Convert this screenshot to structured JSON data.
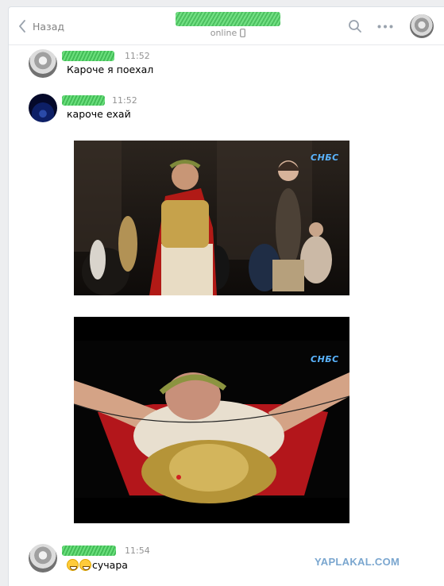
{
  "header": {
    "back_label": "Назад",
    "status": "online"
  },
  "messages": [
    {
      "time": "11:52",
      "text": "Кароче я поехал"
    },
    {
      "time": "11:52",
      "text": "кароче ехай"
    },
    {
      "time": "11:54",
      "text": "сучара"
    }
  ],
  "photos": [
    {
      "channel_logo": "СНБС"
    },
    {
      "channel_logo": "СНБС"
    }
  ],
  "watermark": "YAPLAKAL.COM",
  "colors": {
    "background": "#edeef0",
    "panel": "#ffffff",
    "secondary_text": "#939393",
    "name_scribble": "#43c85a",
    "watermark": "#7aa6cf"
  },
  "icons": [
    "chevron-left-icon",
    "phone-icon",
    "search-icon",
    "more-icon",
    "avatar"
  ]
}
